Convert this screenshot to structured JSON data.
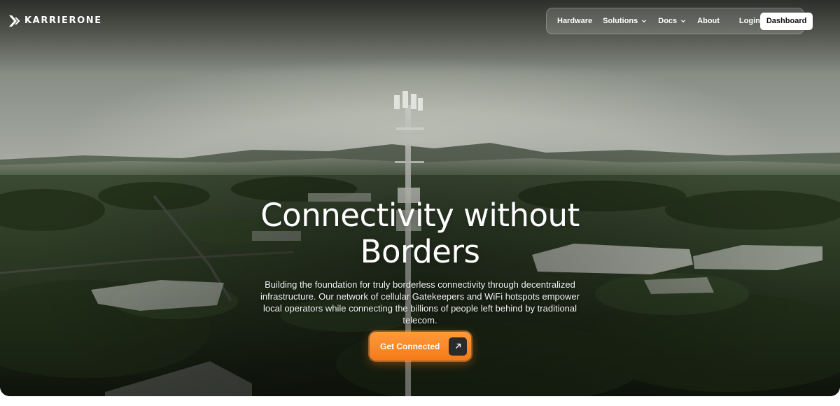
{
  "brand": {
    "name": "KARRIERONE",
    "logo_icon": "karrierone-chevron-logo-icon"
  },
  "nav": {
    "items": [
      {
        "label": "Hardware",
        "has_dropdown": false
      },
      {
        "label": "Solutions",
        "has_dropdown": true
      },
      {
        "label": "Docs",
        "has_dropdown": true
      },
      {
        "label": "About",
        "has_dropdown": false
      }
    ],
    "login_label": "Login",
    "dashboard_label": "Dashboard"
  },
  "hero": {
    "title": "Connectivity without Borders",
    "subtitle": "Building the foundation for truly borderless connectivity through decentralized infrastructure. Our network of cellular Gatekeepers and WiFi hotspots empower local operators while connecting the billions of people left behind by traditional telecom.",
    "background": "aerial-cell-tower-photo",
    "cta": {
      "label": "Get Connected",
      "icon": "arrow-up-right-icon",
      "color": "#f47a16"
    }
  }
}
